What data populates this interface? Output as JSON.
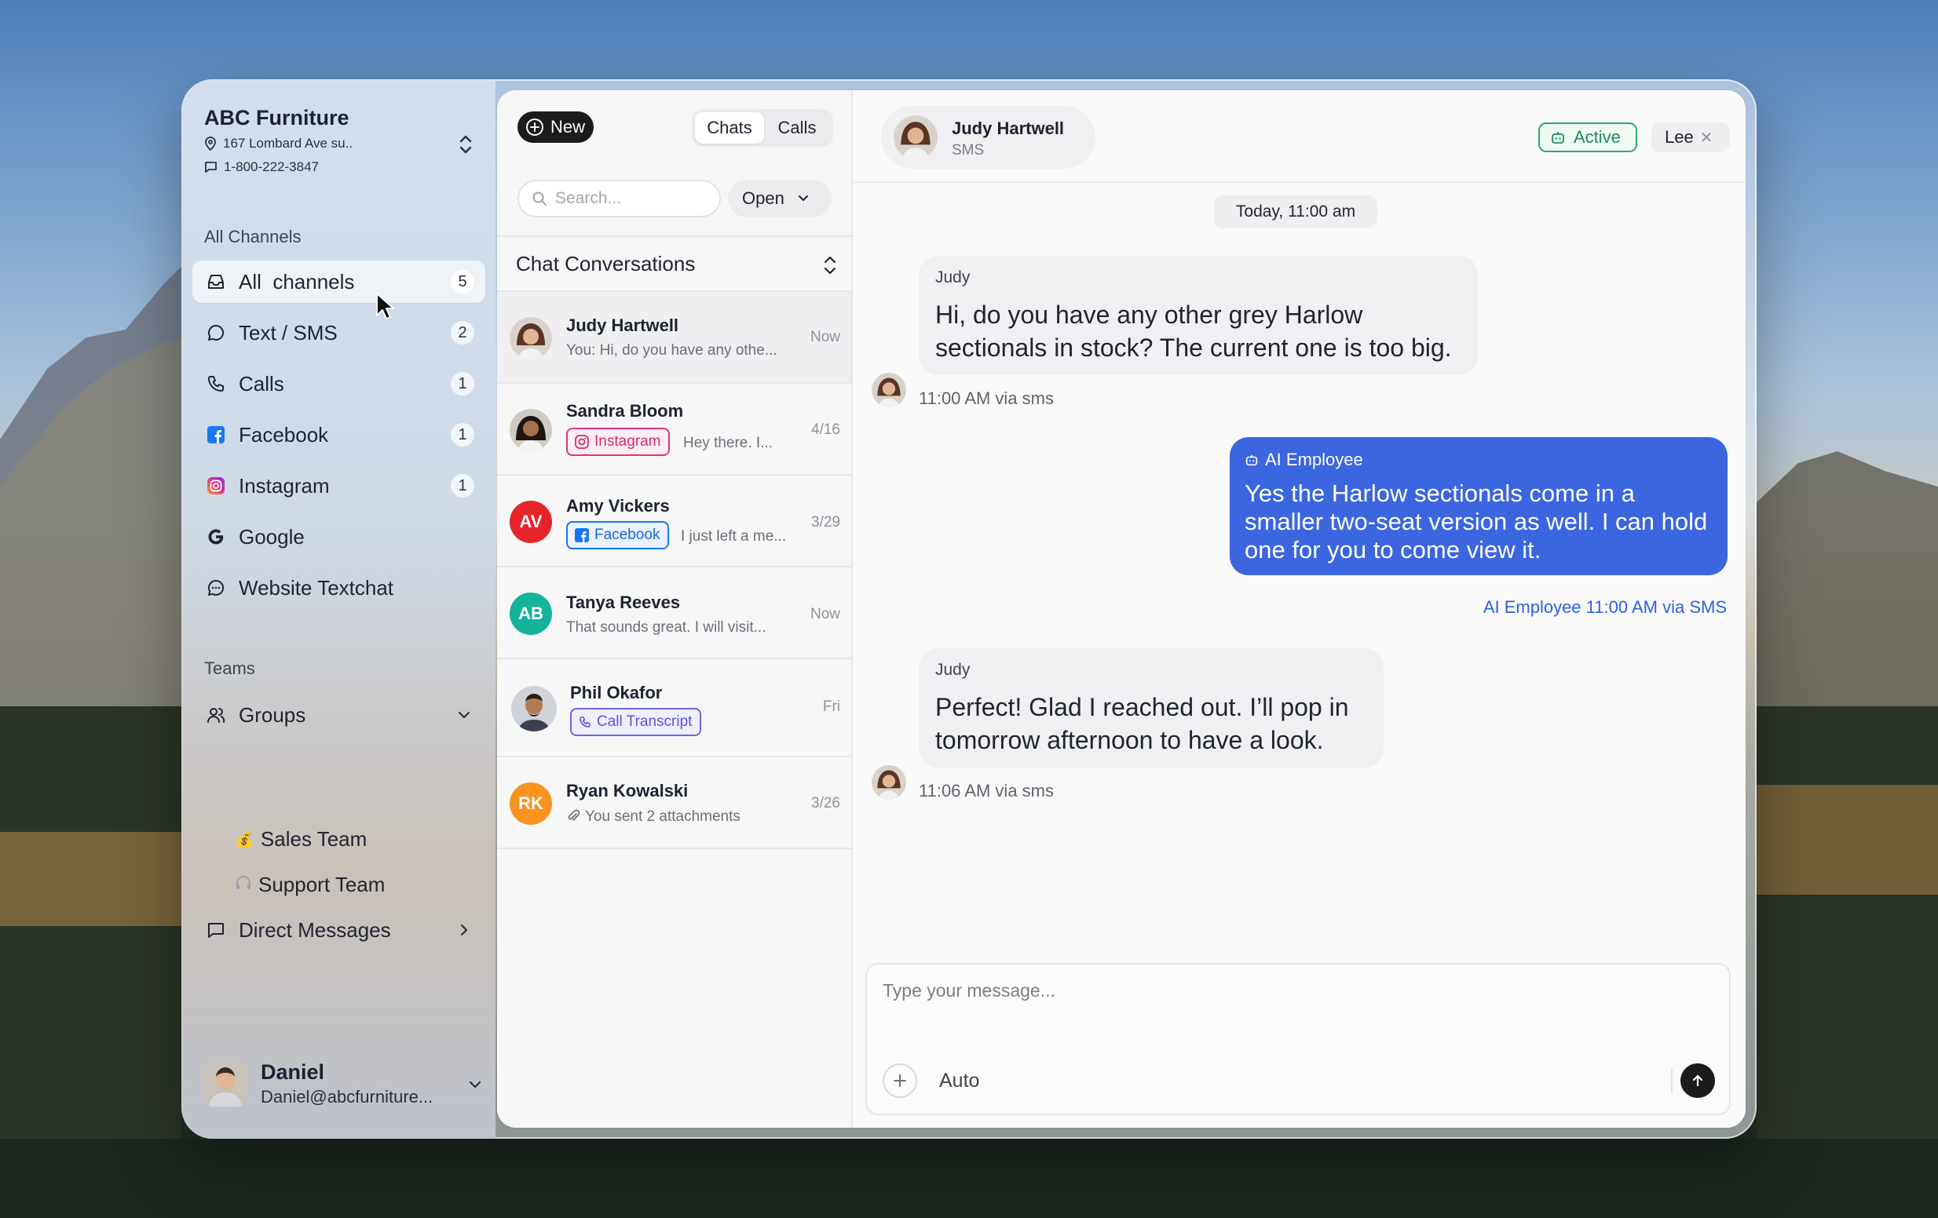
{
  "business": {
    "name": "ABC Furniture",
    "address": "167 Lombard Ave su..",
    "phone": "1-800-222-3847"
  },
  "sidebar": {
    "channels_label": "All Channels",
    "channels": [
      {
        "label": "All  channels",
        "icon": "inbox-icon",
        "count": "5"
      },
      {
        "label": "Text / SMS",
        "icon": "chat-bubble-icon",
        "count": "2"
      },
      {
        "label": "Calls",
        "icon": "phone-icon",
        "count": "1"
      },
      {
        "label": "Facebook",
        "icon": "facebook-icon",
        "count": "1"
      },
      {
        "label": "Instagram",
        "icon": "instagram-icon",
        "count": "1"
      },
      {
        "label": "Google",
        "icon": "google-icon",
        "count": ""
      },
      {
        "label": "Website Textchat",
        "icon": "webchat-icon",
        "count": ""
      }
    ],
    "teams_label": "Teams",
    "groups_label": "Groups",
    "teams": [
      {
        "label": "Sales Team",
        "icon": "money-bag-icon"
      },
      {
        "label": "Support Team",
        "icon": "headphones-icon"
      }
    ],
    "direct_messages_label": "Direct Messages",
    "user": {
      "name": "Daniel",
      "email": "Daniel@abcfurniture..."
    }
  },
  "list": {
    "new_label": "New",
    "tabs": [
      "Chats",
      "Calls"
    ],
    "search_placeholder": "Search...",
    "filter_value": "Open",
    "header": "Chat Conversations",
    "conversations": [
      {
        "name": "Judy Hartwell",
        "preview": "You: Hi, do you have any othe...",
        "time": "Now",
        "initials": "",
        "color": "",
        "chip": ""
      },
      {
        "name": "Sandra Bloom",
        "preview": "Hey there. I...",
        "time": "4/16",
        "initials": "",
        "color": "",
        "chip": "Instagram"
      },
      {
        "name": "Amy Vickers",
        "preview": "I just left a me...",
        "time": "3/29",
        "initials": "AV",
        "color": "#e5252a",
        "chip": "Facebook"
      },
      {
        "name": "Tanya Reeves",
        "preview": "That sounds great. I will visit...",
        "time": "Now",
        "initials": "AB",
        "color": "#14b39b",
        "chip": ""
      },
      {
        "name": "Phil Okafor",
        "preview": "",
        "time": "Fri",
        "initials": "",
        "color": "",
        "chip": "Call Transcript"
      },
      {
        "name": "Ryan Kowalski",
        "preview": "You sent 2 attachments",
        "time": "3/26",
        "initials": "RK",
        "color": "#f7931e",
        "chip": ""
      }
    ]
  },
  "chat": {
    "contact_name": "Judy Hartwell",
    "contact_channel": "SMS",
    "status_label": "Active",
    "assignee": "Lee",
    "date_label": "Today, 11:00 am",
    "messages": [
      {
        "sender": "Judy",
        "text": "Hi, do you have any other grey Harlow sectionals in stock? The current one is too big.",
        "meta": "11:00 AM via sms"
      },
      {
        "sender": "AI Employee",
        "text": "Yes the Harlow sectionals come in a smaller two-seat version as well. I can hold one for you to come view it.",
        "meta": "AI Employee 11:00 AM via SMS"
      },
      {
        "sender": "Judy",
        "text": "Perfect! Glad I reached out. I’ll pop in tomorrow afternoon to have a look.",
        "meta": "11:06 AM via sms"
      }
    ],
    "composer_placeholder": "Type your message...",
    "mode_label": "Auto"
  },
  "colors": {
    "accent_blue": "#3b66e0",
    "active_green": "#1f8a55",
    "instagram_pink": "#e0347d",
    "facebook_blue": "#1877f2",
    "call_purple": "#5b55d6"
  }
}
